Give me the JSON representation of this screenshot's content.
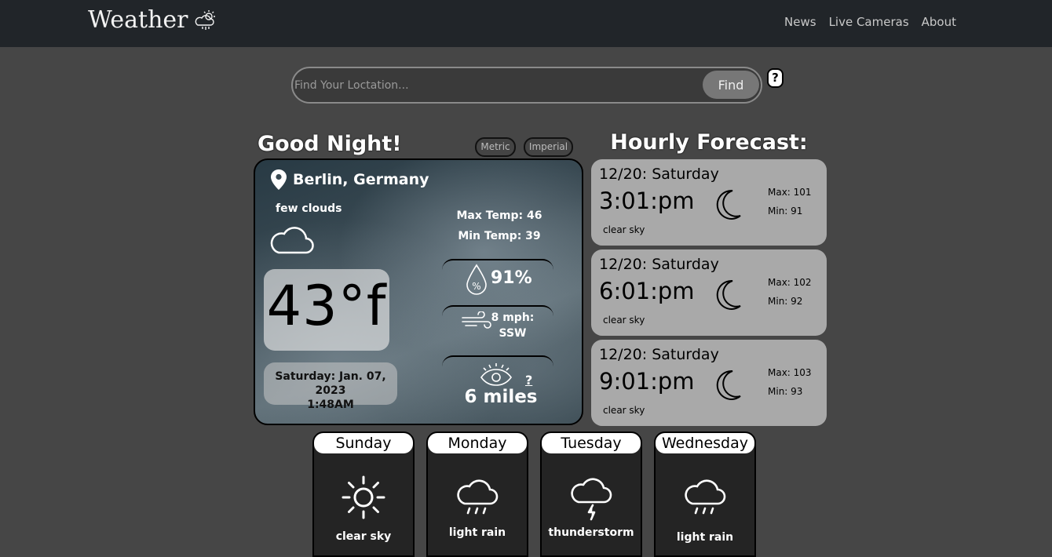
{
  "header": {
    "brand": "Weather",
    "nav": [
      "News",
      "Live Cameras",
      "About"
    ]
  },
  "search": {
    "placeholder": "Find Your Loctation...",
    "find_label": "Find",
    "help_label": "?"
  },
  "current": {
    "greeting": "Good Night!",
    "units": [
      "Metric",
      "Imperial"
    ],
    "location": "Berlin, Germany",
    "description": "few clouds",
    "temperature": "43°f",
    "date": "Saturday: Jan. 07, 2023",
    "time": "1:48AM",
    "max_temp": "Max Temp: 46",
    "min_temp": "Min Temp: 39",
    "humidity": "91%",
    "wind_speed": "8 mph:",
    "wind_dir": "SSW",
    "visibility": "6 miles",
    "visibility_help": "?"
  },
  "hourly": {
    "title": "Hourly Forecast:",
    "items": [
      {
        "date": "12/20: Saturday",
        "time": "3:01:pm",
        "max": "Max: 101",
        "min": "Min: 91",
        "desc": "clear sky"
      },
      {
        "date": "12/20: Saturday",
        "time": "6:01:pm",
        "max": "Max: 102",
        "min": "Min: 92",
        "desc": "clear sky"
      },
      {
        "date": "12/20: Saturday",
        "time": "9:01:pm",
        "max": "Max: 103",
        "min": "Min: 93",
        "desc": "clear sky"
      }
    ]
  },
  "daily": [
    {
      "day": "Sunday",
      "desc": "clear sky",
      "icon": "sun-icon"
    },
    {
      "day": "Monday",
      "desc": "light rain",
      "icon": "rain-cloud-icon"
    },
    {
      "day": "Tuesday",
      "desc": "thunderstorm",
      "icon": "thunderstorm-icon"
    },
    {
      "day": "Wednesday",
      "desc": "light rain",
      "icon": "rain-cloud-icon"
    }
  ],
  "colors": {
    "background": "#464646",
    "header": "#212529",
    "hourly_card": "#a9a9a9",
    "daily_card": "#242424"
  }
}
